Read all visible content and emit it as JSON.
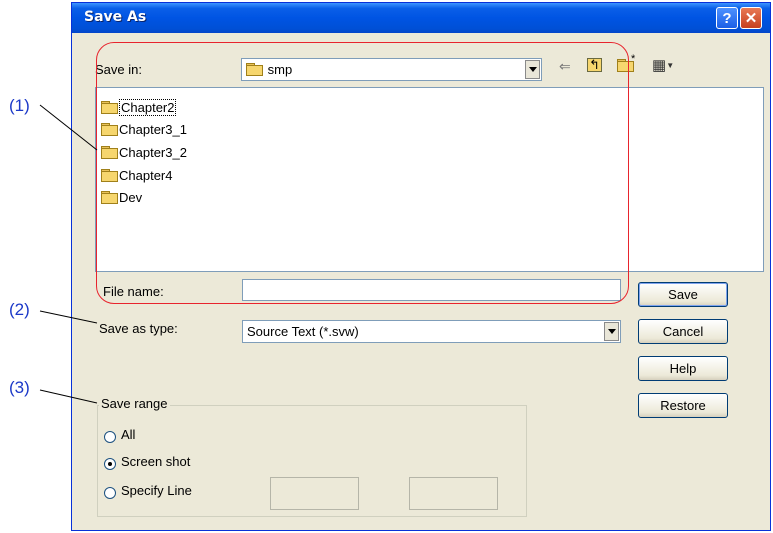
{
  "callouts": [
    "(1)",
    "(2)",
    "(3)"
  ],
  "window": {
    "title": "Save As",
    "help_glyph": "?",
    "close_glyph": "✕"
  },
  "save_in": {
    "label": "Save in:",
    "value": "smp"
  },
  "toolbar": {
    "back_icon": "back-arrow-icon",
    "up_icon": "up-one-level-icon",
    "new_folder_icon": "new-folder-icon",
    "view_menu_icon": "view-menu-icon"
  },
  "folders": [
    "Chapter2",
    "Chapter3_1",
    "Chapter3_2",
    "Chapter4",
    "Dev"
  ],
  "file_name": {
    "label": "File name:",
    "value": ""
  },
  "save_as_type": {
    "label": "Save as type:",
    "value": "Source Text (*.svw)"
  },
  "buttons": {
    "save": "Save",
    "cancel": "Cancel",
    "help": "Help",
    "restore": "Restore"
  },
  "save_range": {
    "title": "Save range",
    "options": [
      "All",
      "Screen shot",
      "Specify Line"
    ],
    "selected": "Screen shot",
    "line_from": "",
    "line_to": "",
    "separator": "~"
  },
  "colors": {
    "callout": "#1c39c8",
    "highlight": "#e8242d",
    "titlebar": "#0054e3"
  }
}
